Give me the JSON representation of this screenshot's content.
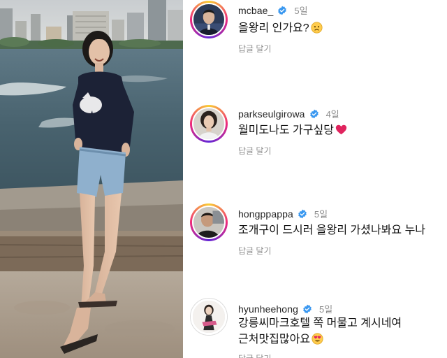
{
  "comments": [
    {
      "username": "mcbae_",
      "time": "5일",
      "text": "을왕리 인가요?",
      "emoji": "sad-face-emoji",
      "reply": "답글 달기"
    },
    {
      "username": "parkseulgirowa",
      "time": "4일",
      "text": "월미도나도 가구싶당",
      "emoji": "red-heart-emoji",
      "reply": "답글 달기"
    },
    {
      "username": "hongppappa",
      "time": "5일",
      "text": "조개구이 드시러 을왕리 가셨나봐요 누나",
      "emoji": "",
      "reply": "답글 달기"
    },
    {
      "username": "hyunheehong",
      "time": "5일",
      "text_line1": "강릉씨마크호텔 쪽 머물고 계시네여",
      "text_line2": "근처맛집많아요",
      "emoji": "heart-eyes-emoji",
      "reply": "답글 달기"
    }
  ],
  "colors": {
    "verified_badge": "#3897f0",
    "meta_text": "#8e8e8e",
    "heart": "#e0245e"
  }
}
